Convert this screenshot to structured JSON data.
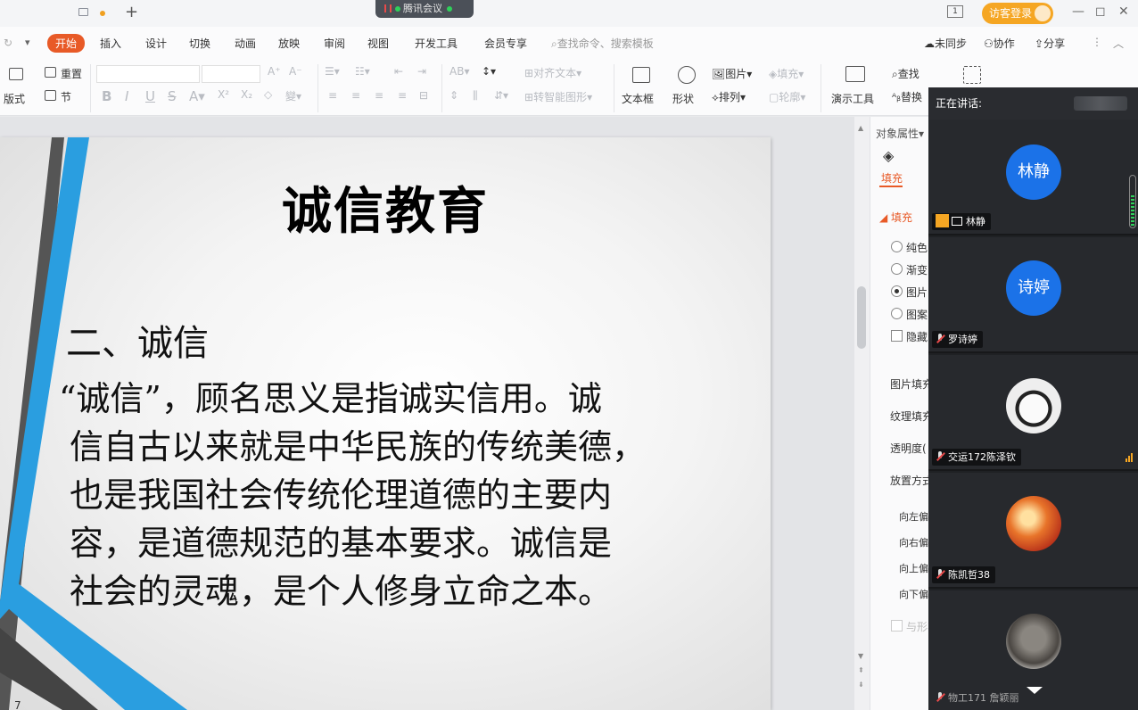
{
  "titlebar": {
    "meeting_label": "腾讯会议",
    "page_indicator": "1",
    "guest_login": "访客登录",
    "window_controls": [
      "—",
      "◻",
      "✕"
    ]
  },
  "menu": {
    "tabs": [
      "开始",
      "插入",
      "设计",
      "切换",
      "动画",
      "放映",
      "审阅",
      "视图",
      "开发工具",
      "会员专享"
    ],
    "active_tab": "开始",
    "search_placeholder": "查找命令、搜索模板",
    "unsynced": "未同步",
    "collaborate": "协作",
    "share": "分享"
  },
  "toolbar": {
    "layout": "版式",
    "reset": "重置",
    "section": "节",
    "align_text": "对齐文本",
    "smart_shape": "转智能图形",
    "textbox": "文本框",
    "shape": "形状",
    "picture": "图片",
    "arrange": "排列",
    "fill": "填充",
    "outline": "轮廓",
    "present_tools": "演示工具",
    "find": "查找",
    "replace": "替换",
    "bold": "B",
    "italic": "I",
    "underline": "U",
    "strike": "S"
  },
  "slide": {
    "title": "诚信教育",
    "subtitle": "二、诚信",
    "body_lines": [
      "“诚信”，顾名思义是指诚实信用。诚",
      "信自古以来就是中华民族的传统美德，",
      "也是我国社会传统伦理道德的主要内",
      "容，是道德规范的基本要求。诚信是",
      "社会的灵魂，是个人修身立命之本。"
    ],
    "number": "7"
  },
  "properties": {
    "header": "对象属性",
    "tab_fill": "填充",
    "section_fill": "填充",
    "options": [
      "纯色",
      "渐变",
      "图片",
      "图案"
    ],
    "selected_option": "图片",
    "hide_bg": "隐藏",
    "picture_fill": "图片填充",
    "texture_fill": "纹理填充",
    "transparency": "透明度(",
    "placement": "放置方式",
    "offsets": [
      "向左偏",
      "向右偏",
      "向上偏",
      "向下偏"
    ],
    "with_shape": "与形状"
  },
  "meeting": {
    "speaking_label": "正在讲话:",
    "participants": [
      {
        "avatar_text": "林静",
        "name": "林静"
      },
      {
        "avatar_text": "诗婷",
        "name": "罗诗婷"
      },
      {
        "avatar_text": "",
        "name": "交运172陈泽钦"
      },
      {
        "avatar_text": "",
        "name": "陈凯哲38"
      },
      {
        "avatar_text": "",
        "name": "物工171 詹颖丽"
      }
    ],
    "accent_blue": "#1b72e8"
  }
}
